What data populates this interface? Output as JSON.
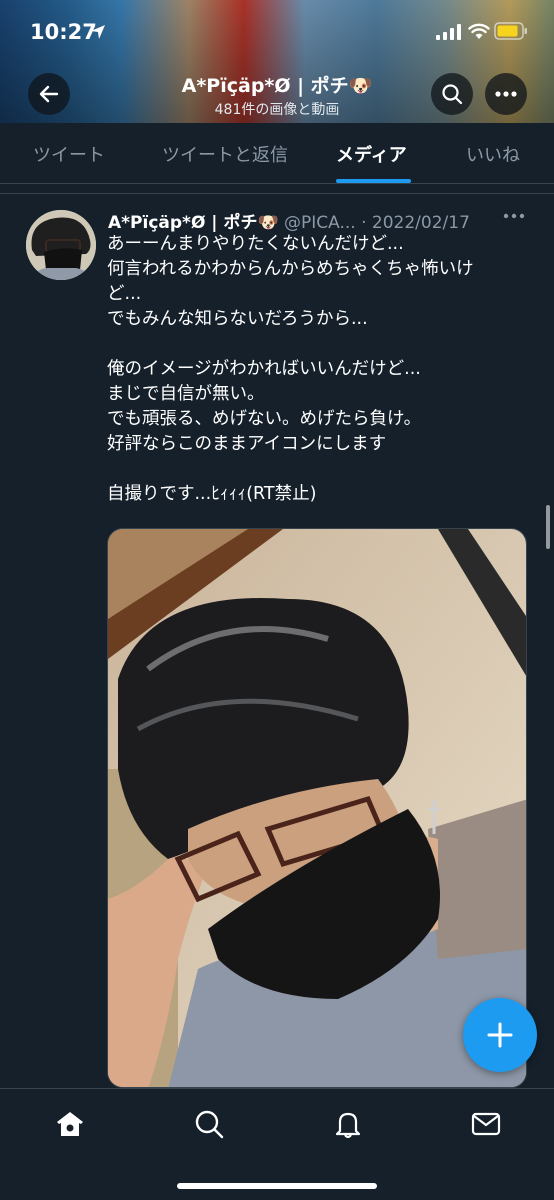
{
  "status_bar": {
    "time": "10:27",
    "icons": [
      "location-arrow-icon",
      "signal-icon",
      "wifi-icon",
      "battery-icon"
    ]
  },
  "header": {
    "display_name": "A*Pïçäp*Ø | ポチ🐶",
    "subtitle": "481件の画像と動画",
    "back_icon": "arrow-left-icon",
    "search_icon": "search-icon",
    "more_icon": "more-horizontal-icon"
  },
  "tabs": [
    {
      "label": "ツイート",
      "active": false
    },
    {
      "label": "ツイートと返信",
      "active": false
    },
    {
      "label": "メディア",
      "active": true
    },
    {
      "label": "いいね",
      "active": false
    }
  ],
  "tweet": {
    "display_name": "A*Pïçäp*Ø | ポチ🐶",
    "handle": "@PICA...",
    "separator": "·",
    "date": "2022/02/17",
    "text_lines": [
      "あーーんまりやりたくないんだけど...",
      "何言われるかわからんからめちゃくちゃ怖いけ",
      "ど...",
      "でもみんな知らないだろうから...",
      "",
      "俺のイメージがわかればいいんだけど...",
      "まじで自信が無い。",
      "でも頑張る、めげない。めげたら負け。",
      "好評ならこのままアイコンにします",
      "",
      "自撮りです...ﾋｨｨｨ(RT禁止)"
    ],
    "media": "selfie-photo"
  },
  "fab_icon": "plus-icon",
  "bottom_nav": [
    "home-icon",
    "search-icon",
    "bell-icon",
    "mail-icon"
  ],
  "colors": {
    "background": "#15202b",
    "accent": "#1d9bf0",
    "secondary_text": "#8b98a5",
    "divider": "#38444d"
  }
}
